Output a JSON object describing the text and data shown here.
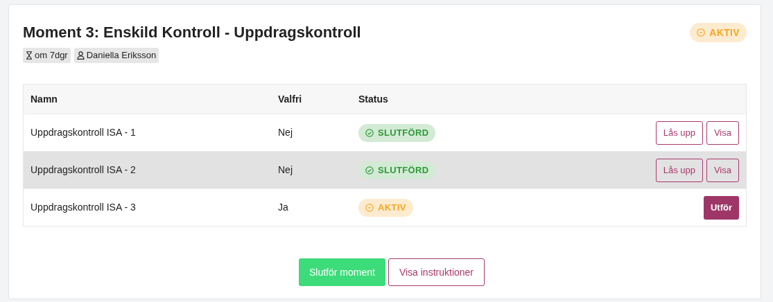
{
  "header": {
    "title": "Moment 3: Enskild Kontroll - Uppdragskontroll",
    "status": {
      "kind": "active",
      "label": "AKTIV"
    },
    "tags": [
      {
        "kind": "time",
        "label": "om 7dgr"
      },
      {
        "kind": "person",
        "label": "Daniella Eriksson"
      }
    ]
  },
  "table": {
    "columns": [
      "Namn",
      "Valfri",
      "Status"
    ],
    "rows": [
      {
        "name": "Uppdragskontroll ISA - 1",
        "optional": "Nej",
        "status": {
          "kind": "done",
          "label": "SLUTFÖRD"
        },
        "highlighted": false,
        "actions": [
          {
            "kind": "outline",
            "label": "Lås upp"
          },
          {
            "kind": "outline",
            "label": "Visa"
          }
        ]
      },
      {
        "name": "Uppdragskontroll ISA - 2",
        "optional": "Nej",
        "status": {
          "kind": "done",
          "label": "SLUTFÖRD"
        },
        "highlighted": true,
        "actions": [
          {
            "kind": "outline",
            "label": "Lås upp"
          },
          {
            "kind": "outline",
            "label": "Visa"
          }
        ]
      },
      {
        "name": "Uppdragskontroll ISA - 3",
        "optional": "Ja",
        "status": {
          "kind": "active",
          "label": "AKTIV"
        },
        "highlighted": false,
        "actions": [
          {
            "kind": "primary",
            "label": "Utför"
          }
        ]
      }
    ]
  },
  "footer": {
    "buttons": [
      {
        "kind": "success",
        "label": "Slutför moment"
      },
      {
        "kind": "outline",
        "label": "Visa instruktioner"
      }
    ]
  }
}
